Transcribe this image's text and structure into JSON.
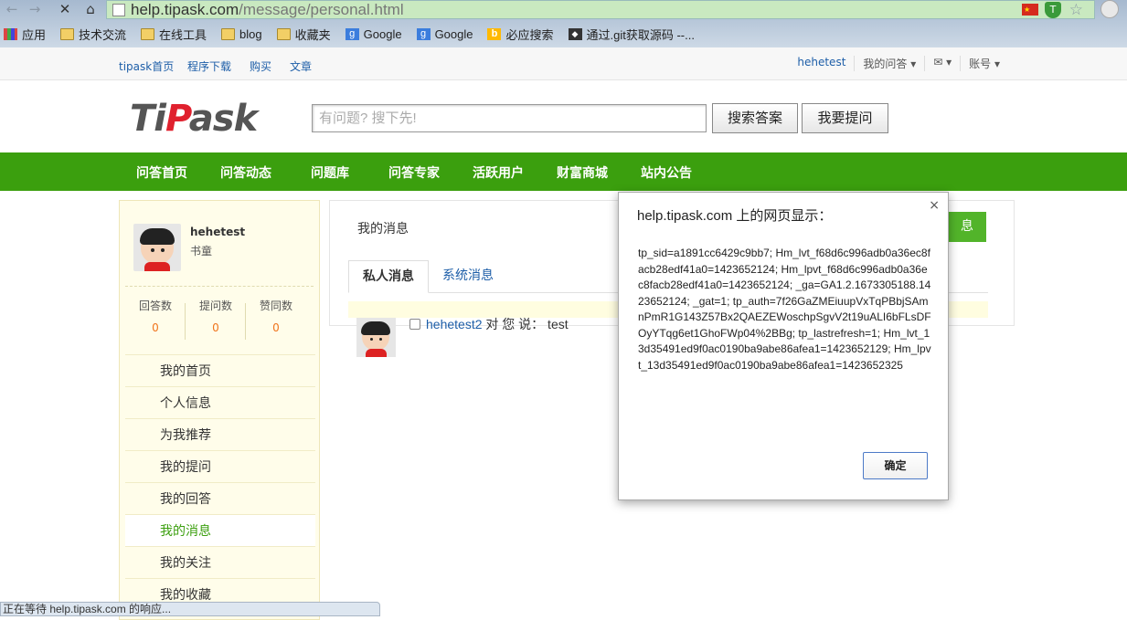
{
  "browser": {
    "url_host": "help.tipask.com",
    "url_path": "/message/personal.html",
    "bookmarks": [
      {
        "label": "应用",
        "icon": "apps-icon"
      },
      {
        "label": "技术交流",
        "icon": "folder-icon"
      },
      {
        "label": "在线工具",
        "icon": "folder-icon"
      },
      {
        "label": "blog",
        "icon": "folder-icon"
      },
      {
        "label": "收藏夹",
        "icon": "folder-icon"
      },
      {
        "label": "Google",
        "icon": "google-icon"
      },
      {
        "label": "Google",
        "icon": "google-icon"
      },
      {
        "label": "必应搜索",
        "icon": "bing-icon"
      },
      {
        "label": "通过.git获取源码 --...",
        "icon": "git-icon"
      }
    ],
    "status_text": "正在等待 help.tipask.com 的响应..."
  },
  "topbar": {
    "links": [
      "tipask首页",
      "程序下载",
      "购买",
      "文章"
    ],
    "username": "hehetest",
    "my_answers": "我的问答 ▾",
    "mail": "✉ ▾",
    "account": "账号 ▾"
  },
  "header": {
    "logo_left": "Ti",
    "logo_mid": "P",
    "logo_right": "ask",
    "search_placeholder": "有问题? 搜下先!",
    "search_button": "搜索答案",
    "ask_button": "我要提问"
  },
  "nav": [
    "问答首页",
    "问答动态",
    "问题库",
    "问答专家",
    "活跃用户",
    "财富商城",
    "站内公告"
  ],
  "sidebar": {
    "username": "hehetest",
    "rank": "书童",
    "stats": [
      {
        "label": "回答数",
        "value": "0"
      },
      {
        "label": "提问数",
        "value": "0"
      },
      {
        "label": "赞同数",
        "value": "0"
      }
    ],
    "menu": [
      "我的首页",
      "个人信息",
      "为我推荐",
      "我的提问",
      "我的回答",
      "我的消息",
      "我的关注",
      "我的收藏"
    ],
    "active_menu": "我的消息"
  },
  "content": {
    "title": "我的消息",
    "send_button": "息",
    "tabs": [
      "私人消息",
      "系统消息"
    ],
    "message": {
      "user": "hehetest2",
      "text": " 对 您 说： test"
    }
  },
  "dialog": {
    "title": "help.tipask.com 上的网页显示：",
    "close": "×",
    "body": "tp_sid=a1891cc6429c9bb7; Hm_lvt_f68d6c996adb0a36ec8facb28edf41a0=1423652124; Hm_lpvt_f68d6c996adb0a36ec8facb28edf41a0=1423652124; _ga=GA1.2.1673305188.1423652124; _gat=1; tp_auth=7f26GaZMEiuupVxTqPBbjSAmnPmR1G143Z57Bx2QAEZEWoschpSgvV2t19uALI6bFLsDFOyYTqg6et1GhoFWp04%2BBg; tp_lastrefresh=1; Hm_lvt_13d35491ed9f0ac0190ba9abe86afea1=1423652129; Hm_lpvt_13d35491ed9f0ac0190ba9abe86afea1=1423652325",
    "ok_button": "确定"
  },
  "colors": {
    "nav_green": "#3b9f0e",
    "link_blue": "#1d5ea8",
    "logo_red": "#e0212e",
    "stat_orange": "#f0741c"
  }
}
